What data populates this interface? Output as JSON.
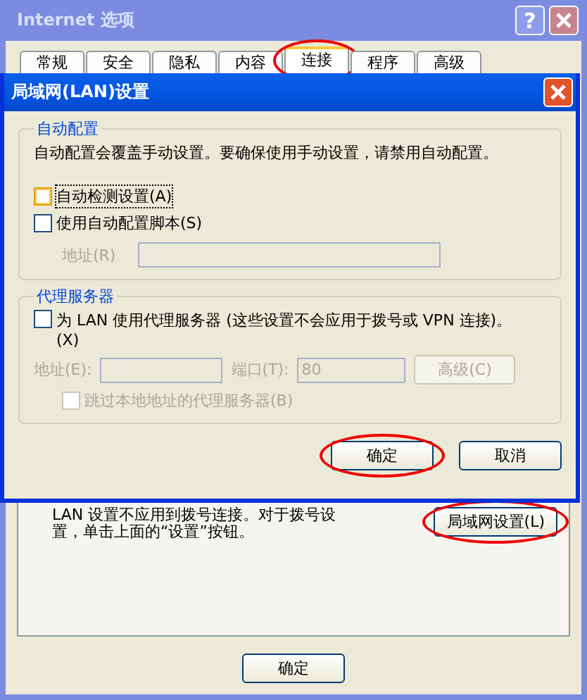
{
  "window": {
    "title": "Internet 选项",
    "help_button": "?",
    "tabs": [
      {
        "label": "常规",
        "selected": false,
        "circled": false
      },
      {
        "label": "安全",
        "selected": false,
        "circled": false
      },
      {
        "label": "隐私",
        "selected": false,
        "circled": false
      },
      {
        "label": "内容",
        "selected": false,
        "circled": false
      },
      {
        "label": "连接",
        "selected": true,
        "circled": true
      },
      {
        "label": "程序",
        "selected": false,
        "circled": false
      },
      {
        "label": "高级",
        "selected": false,
        "circled": false
      }
    ],
    "lan_note": "LAN 设置不应用到拨号连接。对于拨号设置，单击上面的“设置”按钮。",
    "lan_button": {
      "label": "局域网设置(L)",
      "circled": true
    },
    "ok_button": {
      "label": "确定"
    }
  },
  "dialog": {
    "title": "局域网(LAN)设置",
    "auto_config": {
      "heading": "自动配置",
      "description": "自动配置会覆盖手动设置。要确保使用手动设置，请禁用自动配置。",
      "options": [
        {
          "label": "自动检测设置(A)",
          "checked": false,
          "focused": true
        },
        {
          "label": "使用自动配置脚本(S)",
          "checked": false,
          "focused": false
        }
      ],
      "address_label": "地址(R)"
    },
    "proxy": {
      "heading": "代理服务器",
      "option": {
        "label": "为 LAN 使用代理服务器 (这些设置不会应用于拨号或 VPN 连接)。(X)",
        "checked": false
      },
      "address_label": "地址(E):",
      "port_label": "端口(T):",
      "port_value": "80",
      "advanced_button": "高级(C)",
      "bypass": {
        "label": "跳过本地地址的代理服务器(B)",
        "checked": false
      }
    },
    "buttons": [
      {
        "label": "确定",
        "circled": true
      },
      {
        "label": "取消",
        "circled": false
      }
    ]
  }
}
